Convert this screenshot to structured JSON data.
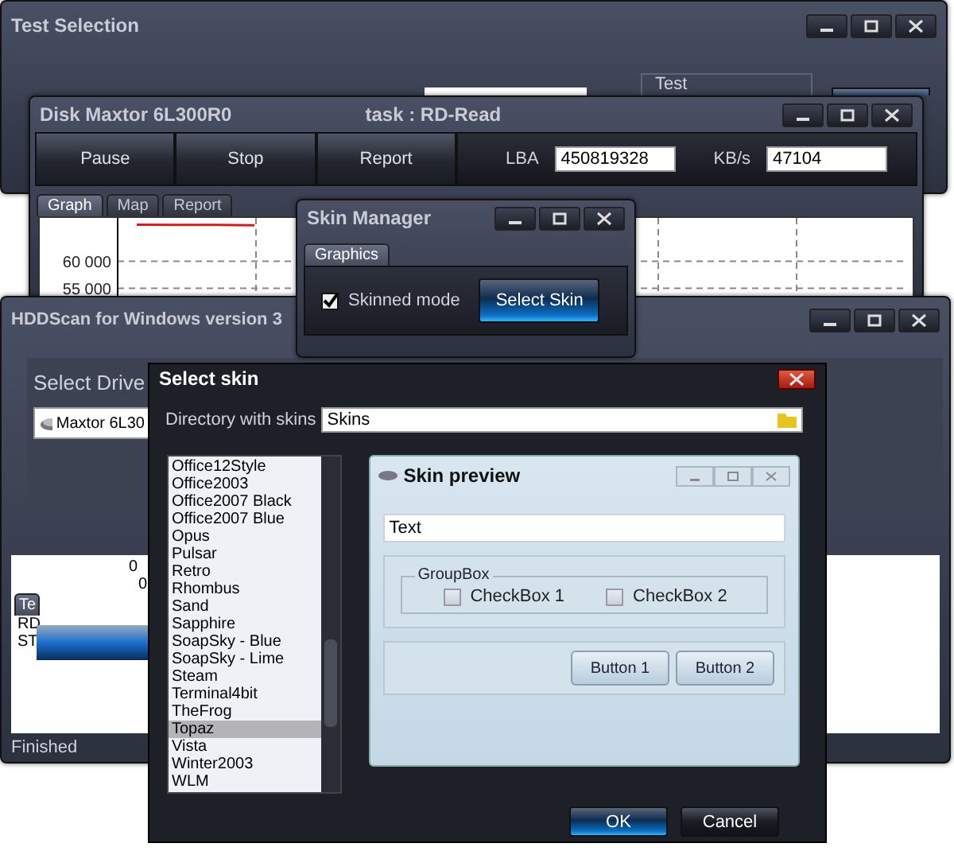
{
  "test_selection": {
    "title": "Test Selection",
    "group_label": "Test"
  },
  "disk_window": {
    "title": "Disk Maxtor 6L300R0",
    "task": "task : RD-Read",
    "buttons": [
      "Pause",
      "Stop",
      "Report"
    ],
    "lba": {
      "label": "LBA",
      "value": "450819328"
    },
    "speed": {
      "label": "KB/s",
      "value": "47104"
    },
    "tabs": [
      {
        "label": "Graph",
        "selected": true
      },
      {
        "label": "Map",
        "selected": false
      },
      {
        "label": "Report",
        "selected": false
      }
    ],
    "chart_data": {
      "type": "line",
      "ylim": [
        53000,
        68000
      ],
      "yticks": [
        {
          "value": 55000,
          "label": "55 000"
        },
        {
          "value": 60000,
          "label": "60 000"
        }
      ],
      "grid": true,
      "series": [
        {
          "color": "#cc2020",
          "values": [
            66750,
            66700,
            66700,
            66650,
            null,
            null,
            null,
            null,
            null,
            null,
            null,
            null,
            null,
            null,
            null,
            null,
            null,
            null,
            null,
            null
          ]
        }
      ]
    }
  },
  "hddscan": {
    "title": "HDDScan for Windows version 3",
    "select_drive_label": "Select Drive",
    "drive": "Maxtor 6L30",
    "axis_labels": [
      "0",
      "0"
    ],
    "tab_fragment": "Te",
    "lines": [
      "RD",
      "ST"
    ],
    "status": "Finished"
  },
  "skin_manager": {
    "title": "Skin Manager",
    "tabs": [
      {
        "label": "Graphics",
        "selected": true
      }
    ],
    "skinned_mode": {
      "label": "Skinned mode",
      "checked": true
    },
    "select_button": "Select Skin"
  },
  "select_skin": {
    "title": "Select skin",
    "directory_label": "Directory with skins",
    "directory": "Skins",
    "skins": [
      {
        "label": "Office12Style",
        "selected": false
      },
      {
        "label": "Office2003",
        "selected": false
      },
      {
        "label": "Office2007 Black",
        "selected": false
      },
      {
        "label": "Office2007 Blue",
        "selected": false
      },
      {
        "label": "Opus",
        "selected": false
      },
      {
        "label": "Pulsar",
        "selected": false
      },
      {
        "label": "Retro",
        "selected": false
      },
      {
        "label": "Rhombus",
        "selected": false
      },
      {
        "label": "Sand",
        "selected": false
      },
      {
        "label": "Sapphire",
        "selected": false
      },
      {
        "label": "SoapSky - Blue",
        "selected": false
      },
      {
        "label": "SoapSky - Lime",
        "selected": false
      },
      {
        "label": "Steam",
        "selected": false
      },
      {
        "label": "Terminal4bit",
        "selected": false
      },
      {
        "label": "TheFrog",
        "selected": false
      },
      {
        "label": "Topaz",
        "selected": true
      },
      {
        "label": "Vista",
        "selected": false
      },
      {
        "label": "Winter2003",
        "selected": false
      },
      {
        "label": "WLM",
        "selected": false
      }
    ],
    "preview": {
      "title": "Skin preview",
      "text_value": "Text",
      "groupbox": "GroupBox",
      "checkboxes": [
        {
          "label": "CheckBox 1",
          "checked": false
        },
        {
          "label": "CheckBox 2",
          "checked": false
        }
      ],
      "buttons": [
        "Button 1",
        "Button 2"
      ]
    },
    "ok": "OK",
    "cancel": "Cancel"
  }
}
